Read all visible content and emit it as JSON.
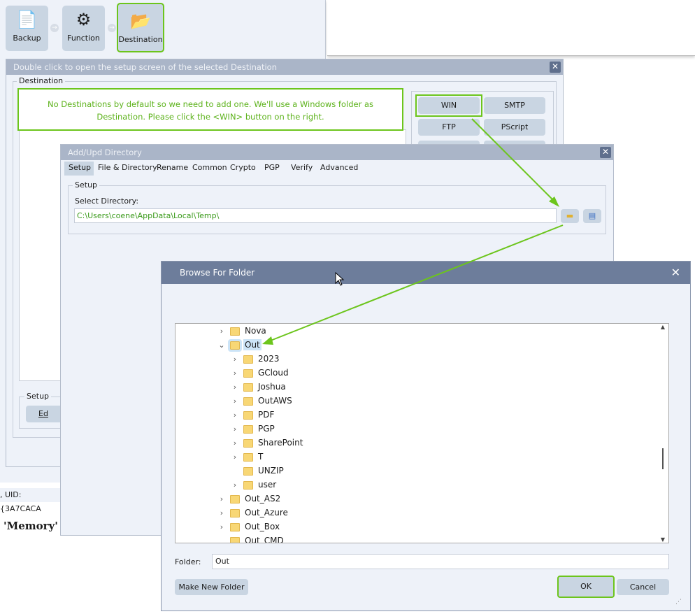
{
  "workflow_steps": [
    {
      "label": "Backup",
      "icon": "documents-icon"
    },
    {
      "label": "Function",
      "icon": "gear-icon"
    },
    {
      "label": "Destination",
      "icon": "folder-arrow-icon"
    }
  ],
  "destination_dialog": {
    "title": "Double click to open the setup screen of the selected Destination",
    "group_label": "Destination",
    "note": "No Destinations by default so we need to add one. We'll use a Windows folder as Destination. Please click the <WIN> button on the right.",
    "buttons": [
      "WIN",
      "SMTP",
      "FTP",
      "PScript"
    ],
    "setup_group": "Setup",
    "edit_button": "Ed"
  },
  "status": {
    "uid_text": ", UID: {3A7CACA",
    "memory_text": "'Memory'"
  },
  "dir_dialog": {
    "title": "Add/Upd Directory",
    "tabs": [
      "Setup",
      "File & Directory",
      "Rename",
      "Common",
      "Crypto",
      "PGP",
      "Verify",
      "Advanced"
    ],
    "active_tab": "Setup",
    "group_label": "Setup",
    "select_label": "Select Directory:",
    "path": "C:\\Users\\coene\\AppData\\Local\\Temp\\"
  },
  "browse_dialog": {
    "title": "Browse For Folder",
    "tree": [
      {
        "name": "Nova",
        "level": 0,
        "chevron": ">"
      },
      {
        "name": "Out",
        "level": 0,
        "chevron": "v",
        "selected": true
      },
      {
        "name": "2023",
        "level": 1,
        "chevron": ">"
      },
      {
        "name": "GCloud",
        "level": 1,
        "chevron": ">"
      },
      {
        "name": "Joshua",
        "level": 1,
        "chevron": ">"
      },
      {
        "name": "OutAWS",
        "level": 1,
        "chevron": ">"
      },
      {
        "name": "PDF",
        "level": 1,
        "chevron": ">"
      },
      {
        "name": "PGP",
        "level": 1,
        "chevron": ">"
      },
      {
        "name": "SharePoint",
        "level": 1,
        "chevron": ">"
      },
      {
        "name": "T",
        "level": 1,
        "chevron": ">"
      },
      {
        "name": "UNZIP",
        "level": 1,
        "chevron": ""
      },
      {
        "name": "user",
        "level": 1,
        "chevron": ">"
      },
      {
        "name": "Out_AS2",
        "level": 0,
        "chevron": ">"
      },
      {
        "name": "Out_Azure",
        "level": 0,
        "chevron": ">"
      },
      {
        "name": "Out_Box",
        "level": 0,
        "chevron": ">"
      },
      {
        "name": "Out_CMD",
        "level": 0,
        "chevron": ""
      }
    ],
    "folder_label": "Folder:",
    "folder_value": "Out",
    "make_new_folder": "Make New Folder",
    "ok": "OK",
    "cancel": "Cancel"
  },
  "colors": {
    "highlight": "#6cc51c",
    "titlebar": "#aab5c8",
    "browse_titlebar": "#6d7d9b"
  }
}
